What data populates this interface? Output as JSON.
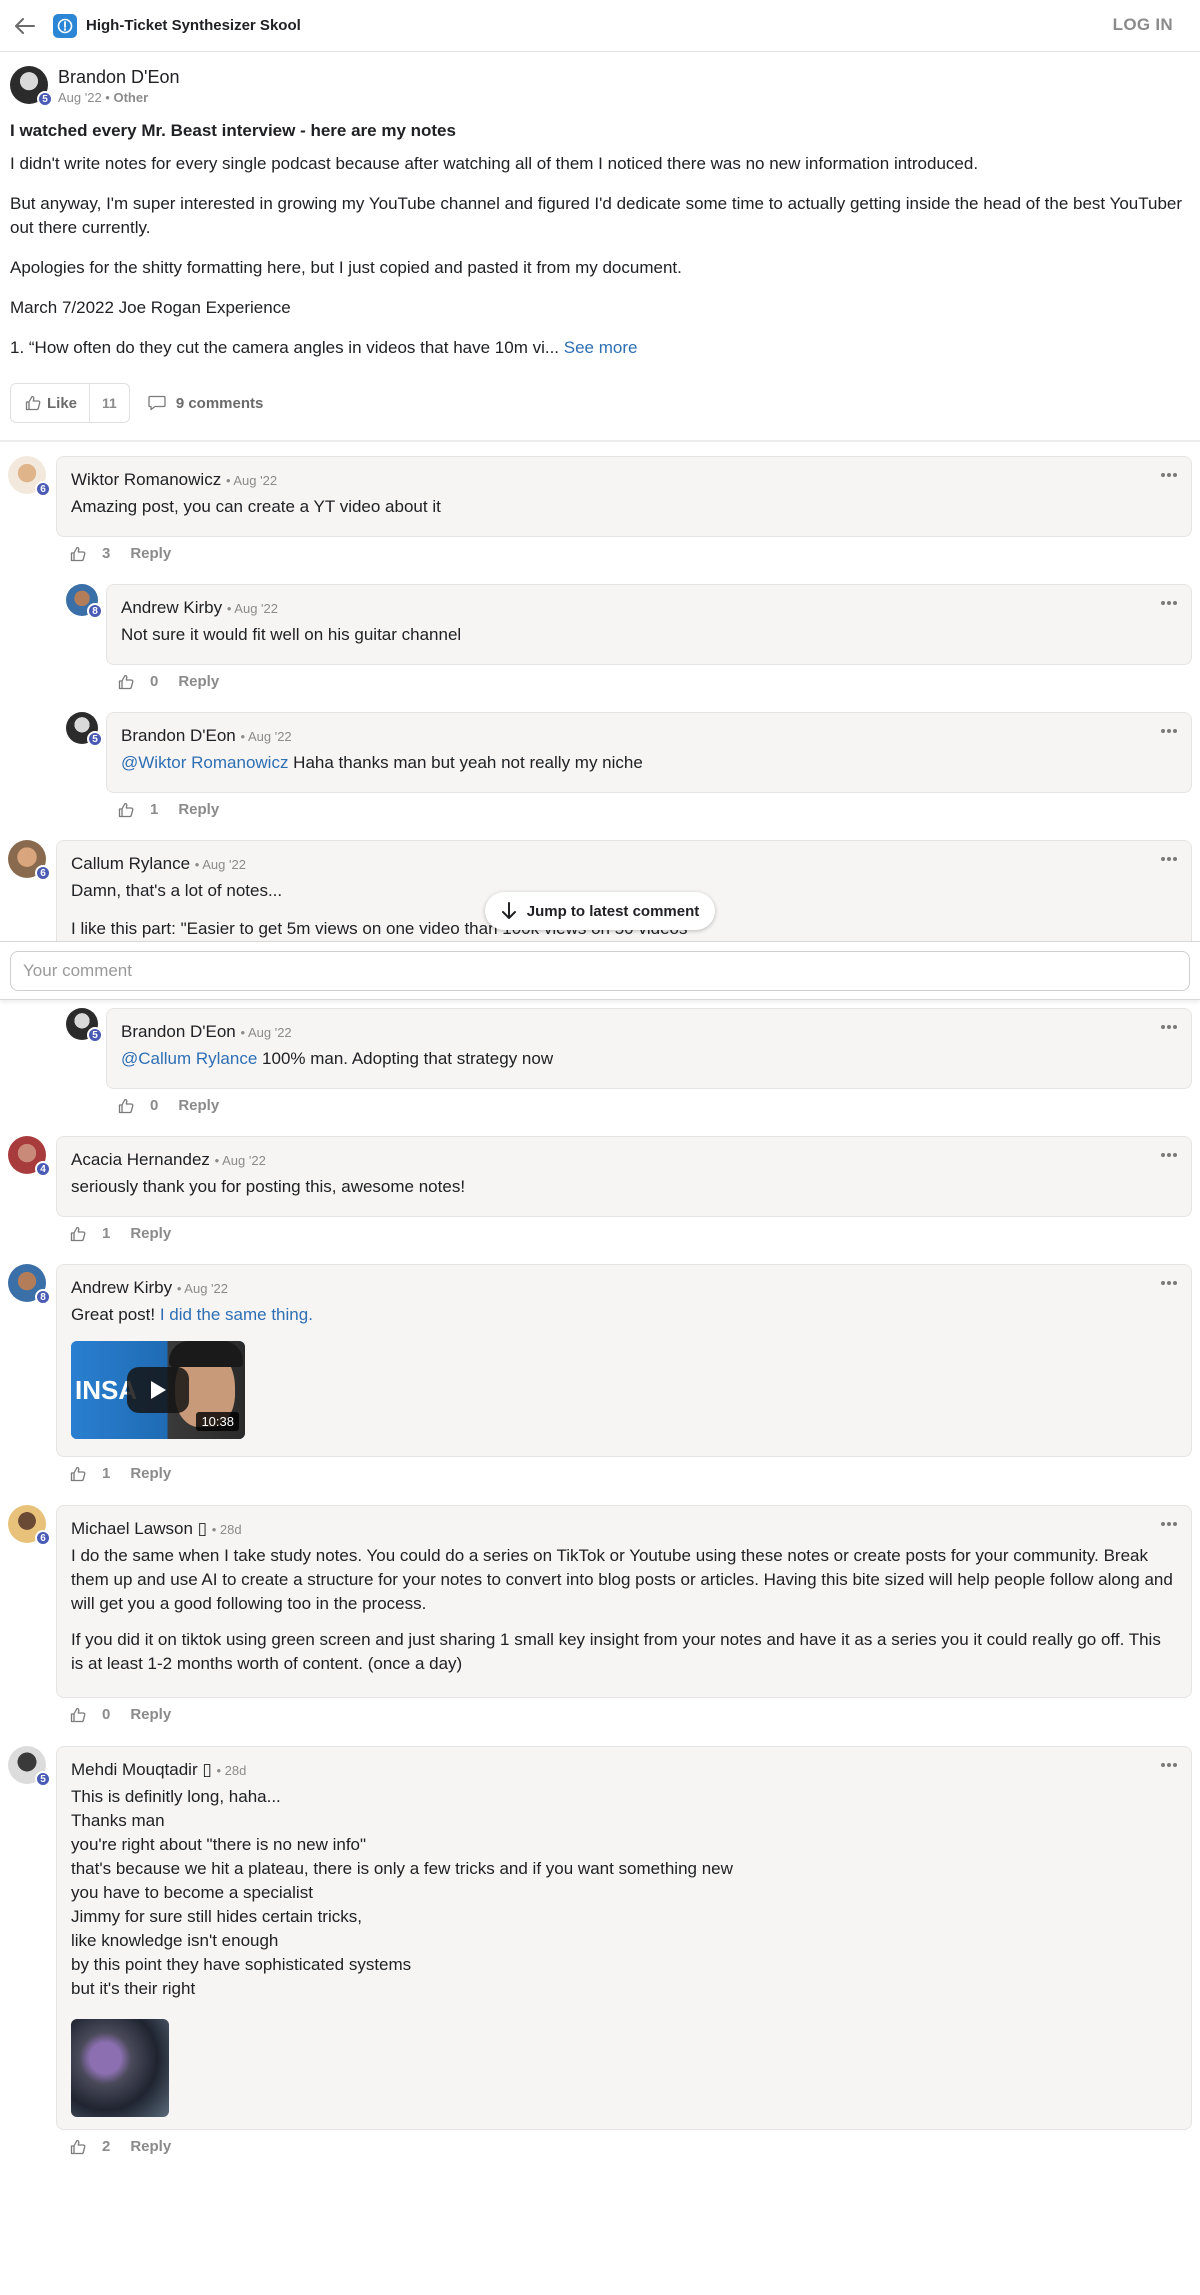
{
  "header": {
    "group_name": "High-Ticket Synthesizer Skool",
    "login_label": "LOG IN"
  },
  "post": {
    "author": "Brandon D'Eon",
    "author_level": "5",
    "date": "Aug '22",
    "category": "Other",
    "title": "I watched every Mr. Beast interview - here are my notes",
    "paragraphs": [
      "I didn't write notes for every single podcast because after watching all of them I noticed there was no new information introduced.",
      "But anyway, I'm super interested in growing my YouTube channel and figured I'd dedicate some time to actually getting inside the head of the best YouTuber out there currently.",
      "Apologies for the shitty formatting here, but I just copied and pasted it from my document.",
      "March 7/2022 Joe Rogan Experience"
    ],
    "truncated_line": "1. “How often do they cut the camera angles in videos that have 10m vi...",
    "see_more": "See more",
    "like_label": "Like",
    "like_count": "11",
    "comments_label": "9 comments"
  },
  "comments": [
    {
      "name": "Wiktor Romanowicz",
      "level": "6",
      "time": "Aug '22",
      "text": "Amazing post, you can create a YT video about it",
      "likes": "3",
      "reply": "Reply"
    },
    {
      "name": "Andrew Kirby",
      "level": "8",
      "time": "Aug '22",
      "text": "Not sure it would fit well on his guitar channel",
      "likes": "0",
      "reply": "Reply"
    },
    {
      "name": "Brandon D'Eon",
      "level": "5",
      "time": "Aug '22",
      "mention": "@Wiktor Romanowicz",
      "text": " Haha thanks man but yeah not really my niche",
      "likes": "1",
      "reply": "Reply"
    },
    {
      "name": "Callum Rylance",
      "level": "6",
      "time": "Aug '22",
      "text": "Damn, that's a lot of notes...",
      "text2": "I like this part: \"Easier to get 5m views on one video than 100k views on 50 videos\""
    },
    {
      "name": "Brandon D'Eon",
      "level": "5",
      "time": "Aug '22",
      "mention": "@Callum Rylance",
      "text": " 100% man. Adopting that strategy now",
      "likes": "0",
      "reply": "Reply"
    },
    {
      "name": "Acacia Hernandez",
      "level": "4",
      "time": "Aug '22",
      "text": "seriously thank you for posting this, awesome notes!",
      "likes": "1",
      "reply": "Reply"
    },
    {
      "name": "Andrew Kirby",
      "level": "8",
      "time": "Aug '22",
      "text": "Great post! ",
      "link": "I did the same thing.",
      "video_duration": "10:38",
      "video_text": "INSA",
      "likes": "1",
      "reply": "Reply"
    },
    {
      "name": "Michael Lawson",
      "name_badge": "▯",
      "level": "6",
      "time": "28d",
      "text": "I do the same when I take study notes. You could do a series on TikTok or Youtube using these notes or create posts for your community. Break them up and use AI to create a structure for your notes to convert into blog posts or articles. Having this bite sized will help people follow along and will get you a good following too in the process.",
      "text2": "If you did it on tiktok using green screen and just sharing 1 small key insight from your notes and have it as a series you it could really go off. This is at least 1-2 months worth of content. (once a day)",
      "likes": "0",
      "reply": "Reply"
    },
    {
      "name": "Mehdi Mouqtadir",
      "name_badge": "▯",
      "level": "5",
      "time": "28d",
      "lines": [
        "This is definitly long, haha...",
        "Thanks man",
        "you're right about \"there is no new info\"",
        "that's because we hit a plateau, there is only a few tricks and if you want something new",
        "you have to become a specialist",
        "Jimmy for sure still hides certain tricks,",
        "like knowledge isn't enough",
        "by this point they have sophisticated systems",
        "but it's their right"
      ],
      "likes": "2",
      "reply": "Reply"
    }
  ],
  "jump_label": "Jump to latest comment",
  "comment_input": {
    "placeholder": "Your comment",
    "value": ""
  },
  "colors": {
    "level_badge": "#4a5bb5",
    "link": "#2e6fb4",
    "bubble_bg": "#f6f5f4"
  }
}
